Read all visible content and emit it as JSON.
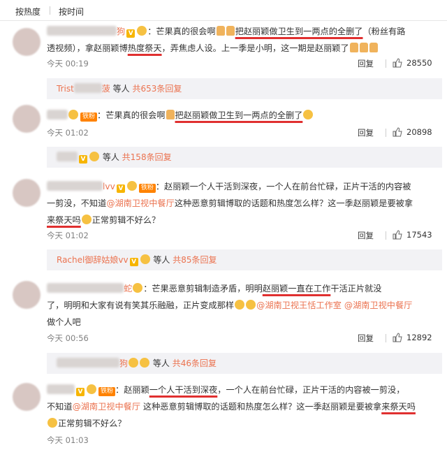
{
  "sort": {
    "hot": "按热度",
    "time": "按时间"
  },
  "comments": [
    {
      "line1": {
        "colon": "：芒果真的很会啊",
        "highlight": "把赵丽颖做卫生到一两点的全删了",
        "tail": "（粉丝有路"
      },
      "line2": {
        "a": "透视频），拿赵丽颖博",
        "highlight": "热度祭天",
        "b": "，弄焦虑人设。上一季是小明，这一期是赵丽颖了"
      },
      "username_suffix": "狗",
      "time": "今天 00:19",
      "reply": "回复",
      "likes": "28550",
      "sub": {
        "name": "Trist",
        "name_suffix": "菠",
        "etc": "等人",
        "more": "共653条回复"
      }
    },
    {
      "line1": {
        "colon": "：芒果真的很会啊",
        "highlight": "把赵丽颖做卫生到一两点的全删了"
      },
      "badge": "铁粉",
      "time": "今天 01:02",
      "reply": "回复",
      "likes": "20898",
      "sub": {
        "etc": "等人",
        "more": "共158条回复"
      }
    },
    {
      "username_suffix": "lvv",
      "badge": "铁粉",
      "line1": {
        "colon": "：赵丽颖一个人干活到深夜，一个人在前台忙碌，正片干活的内容被"
      },
      "line2": {
        "a": "一剪没，不知道",
        "mention": "@湖南卫视中餐厅",
        "b": "这种恶意剪辑博取的话题和热度怎么样？这一季赵丽颖是要被拿"
      },
      "line3": {
        "highlight": "来祭天吗",
        "b": "正常剪辑不好么？"
      },
      "time": "今天 01:02",
      "reply": "回复",
      "likes": "17543",
      "sub": {
        "name": "Rachel御辞姑娘vv",
        "etc": "等人",
        "more": "共85条回复"
      }
    },
    {
      "username_suffix": "蛇",
      "line1": {
        "colon": "：芒果恶意剪辑制造矛盾，明明",
        "highlight": "赵丽颖一直在工作",
        "b": "干活正片就没"
      },
      "line2": {
        "a": "了，明明和大家有说有笑其乐融融，正片变成那样",
        "mention1": "@湖南卫视王恬工作室",
        "mention2": "@湖南卫视中餐厅"
      },
      "line3": {
        "a": "做个人吧"
      },
      "time": "今天 00:56",
      "reply": "回复",
      "likes": "12892",
      "sub": {
        "name_suffix": "狗",
        "etc": "等人",
        "more": "共46条回复"
      }
    },
    {
      "badge": "铁粉",
      "line1": {
        "colon": "：赵丽颖",
        "highlight": "一个人干活到深夜",
        "b": "，一个人在前台忙碌，正片干活的内容被一剪没，"
      },
      "line2": {
        "a": "不知道",
        "mention": "@湖南卫视中餐厅",
        "b": " 这种恶意剪辑博取的话题和热度怎么样？这一季赵丽颖是要被拿",
        "highlight": "来祭天吗"
      },
      "line3": {
        "b": "正常剪辑不好么？"
      },
      "time": "今天 01:03"
    }
  ]
}
